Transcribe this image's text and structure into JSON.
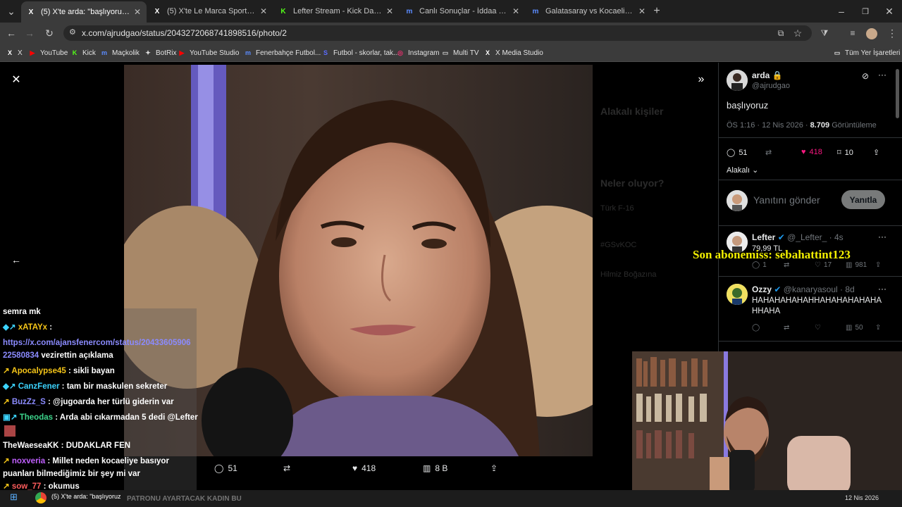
{
  "tabs": [
    {
      "title": "(5) X'te arda: \"başlıyoruz https:/",
      "fav": "X",
      "favcolor": "#fff",
      "active": true
    },
    {
      "title": "(5) X'te Le Marca Sports: \"Koca",
      "fav": "X",
      "favcolor": "#fff",
      "active": false
    },
    {
      "title": "Lefter Stream - Kick Dashboard",
      "fav": "K",
      "favcolor": "#53fc18",
      "active": false
    },
    {
      "title": "Canlı Sonuçlar - İddaa Sonuçlar",
      "fav": "m",
      "favcolor": "#5b8cff",
      "active": false
    },
    {
      "title": "Galatasaray vs Kocaelispor, 12.0",
      "fav": "m",
      "favcolor": "#5b8cff",
      "active": false
    }
  ],
  "url": "x.com/ajrudgao/status/2043272068741898516/photo/2",
  "bookmarks": [
    {
      "label": "X",
      "icon": "X",
      "color": "#fff"
    },
    {
      "label": "YouTube",
      "icon": "▶",
      "color": "#ff0000"
    },
    {
      "label": "Kick",
      "icon": "K",
      "color": "#53fc18"
    },
    {
      "label": "Maçkolik",
      "icon": "m",
      "color": "#5b8cff"
    },
    {
      "label": "BotRix",
      "icon": "✦",
      "color": "#ddd"
    },
    {
      "label": "YouTube Studio",
      "icon": "▶",
      "color": "#ff0000"
    },
    {
      "label": "Fenerbahçe Futbol...",
      "icon": "m",
      "color": "#5b8cff"
    },
    {
      "label": "Futbol - skorlar, tak...",
      "icon": "S",
      "color": "#5b6cff"
    },
    {
      "label": "Instagram",
      "icon": "◎",
      "color": "#e1306c"
    },
    {
      "label": "Multi TV",
      "icon": "▭",
      "color": "#ccc"
    },
    {
      "label": "X Media Studio",
      "icon": "X",
      "color": "#fff"
    }
  ],
  "all_bookmarks": "Tüm Yer İşaretleri",
  "photo_actions": {
    "replies": "51",
    "likes": "418",
    "views": "8 B"
  },
  "tweet": {
    "name": "arda",
    "handle": "@ajrudgao",
    "text": "başlıyoruz",
    "time": "ÖS 1:16 · 12 Nis 2026 · ",
    "views": "8.709",
    "views_label": " Görüntüleme",
    "replies": "51",
    "likes": "418",
    "bookmarks": "10",
    "relevance": "Alakalı",
    "reply_placeholder": "Yanıtını gönder",
    "reply_button": "Yanıtla"
  },
  "replies": [
    {
      "name": "Lefter",
      "handle": "@_Lefter_ · 4s",
      "text": "79,99 TL",
      "replies": "1",
      "likes": "17",
      "views": "981"
    },
    {
      "name": "Ozzy",
      "handle": "@kanaryasoul · 8d",
      "text": "HAHAHAHAHAHHAHAHAHAHAHA HHAHA",
      "replies": "",
      "likes": "",
      "views": "50"
    }
  ],
  "overlay_sub": "Son abonemiss: sebahattint123",
  "bg_dim": {
    "related": "Alakalı kişiler",
    "trends": "Neler oluyor?",
    "trend1": "Türk F-16",
    "trend2": "#GSvKOC",
    "trend3": "Hilmiz Boğazına"
  },
  "chat": [
    {
      "user": "semra mk",
      "ucolor": "#ffffff",
      "msg": "",
      "badge": ""
    },
    {
      "user": "xATAYx",
      "ucolor": "#f5c518",
      "msg": " : ",
      "badge": "◆↗"
    },
    {
      "user": "https://x.com/ajansfenercom/status/20433605906 22580834",
      "ucolor": "#8b8bff",
      "msg": " vezirettin açıklama",
      "badge": ""
    },
    {
      "user": "Apocalypse45",
      "ucolor": "#f5c518",
      "msg": " : sikli bayan",
      "badge": "↗"
    },
    {
      "user": "CanzFener",
      "ucolor": "#3cd4ff",
      "msg": " : tam bir maskulen sekreter",
      "badge": "◆↗"
    },
    {
      "user": "BuzZz_S",
      "ucolor": "#8b8bff",
      "msg": " : @jugoarda her türlü giderin var",
      "badge": "↗"
    },
    {
      "user": "Theodas",
      "ucolor": "#3cd48b",
      "msg": " : Arda abi cıkarmadan 5 dedi @Lefter",
      "badge": "▣↗"
    },
    {
      "user": "TheWaeseaKK",
      "ucolor": "#ffffff",
      "msg": " : DUDAKLAR FEN",
      "badge": ""
    },
    {
      "user": "noxveria",
      "ucolor": "#c060ff",
      "msg": " : Millet neden kocaeliye basıyor",
      "badge": "↗"
    },
    {
      "user": "puanları bilmediğimiz bir şey mi var",
      "ucolor": "#ffffff",
      "msg": "",
      "badge": ""
    },
    {
      "user": "sow_77",
      "ucolor": "#ff5c5c",
      "msg": " : okumus",
      "badge": "↗"
    }
  ],
  "taskbar": {
    "app_title": "(5) X'te arda: \"başlıyoruz",
    "ticker": "PATRONU AYARTACAK KADIN BU",
    "date": "12 Nis 2026"
  }
}
